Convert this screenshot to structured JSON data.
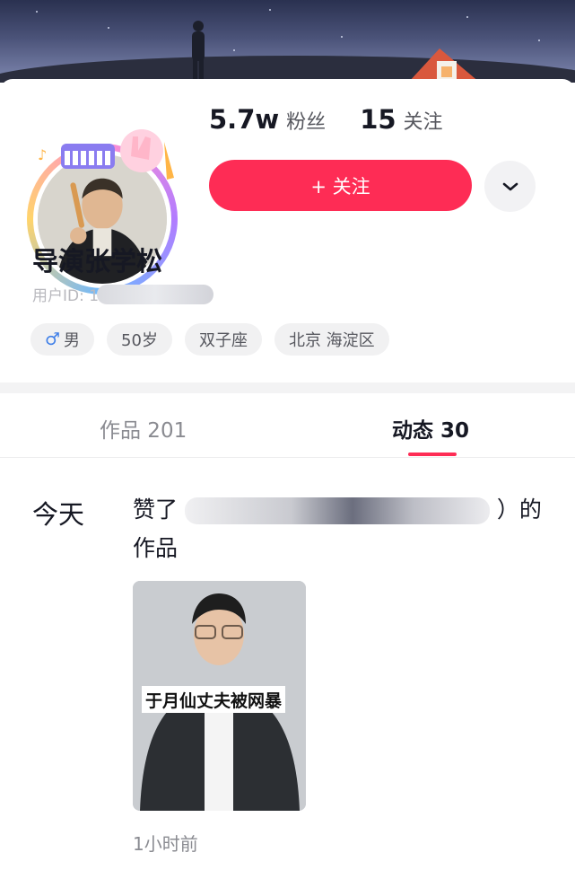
{
  "profile": {
    "followers_count": "5.7w",
    "followers_label": "粉丝",
    "following_count": "15",
    "following_label": "关注",
    "follow_button": "+ 关注",
    "name": "导演张学松",
    "user_id_label": "用户ID: 1",
    "tags": [
      {
        "icon": "male-icon",
        "label": "男"
      },
      {
        "label": "50岁"
      },
      {
        "label": "双子座"
      },
      {
        "label": "北京 海淀区"
      }
    ]
  },
  "tabs": [
    {
      "label": "作品 201",
      "active": false
    },
    {
      "label": "动态 30",
      "active": true
    }
  ],
  "feed": [
    {
      "date": "今天",
      "text_prefix": "赞了",
      "text_suffix": "）的作品",
      "video_caption": "于月仙丈夫被网暴",
      "time": "1小时前"
    }
  ],
  "colors": {
    "accent": "#fe2c55",
    "tag_background": "#f1f1f2"
  }
}
